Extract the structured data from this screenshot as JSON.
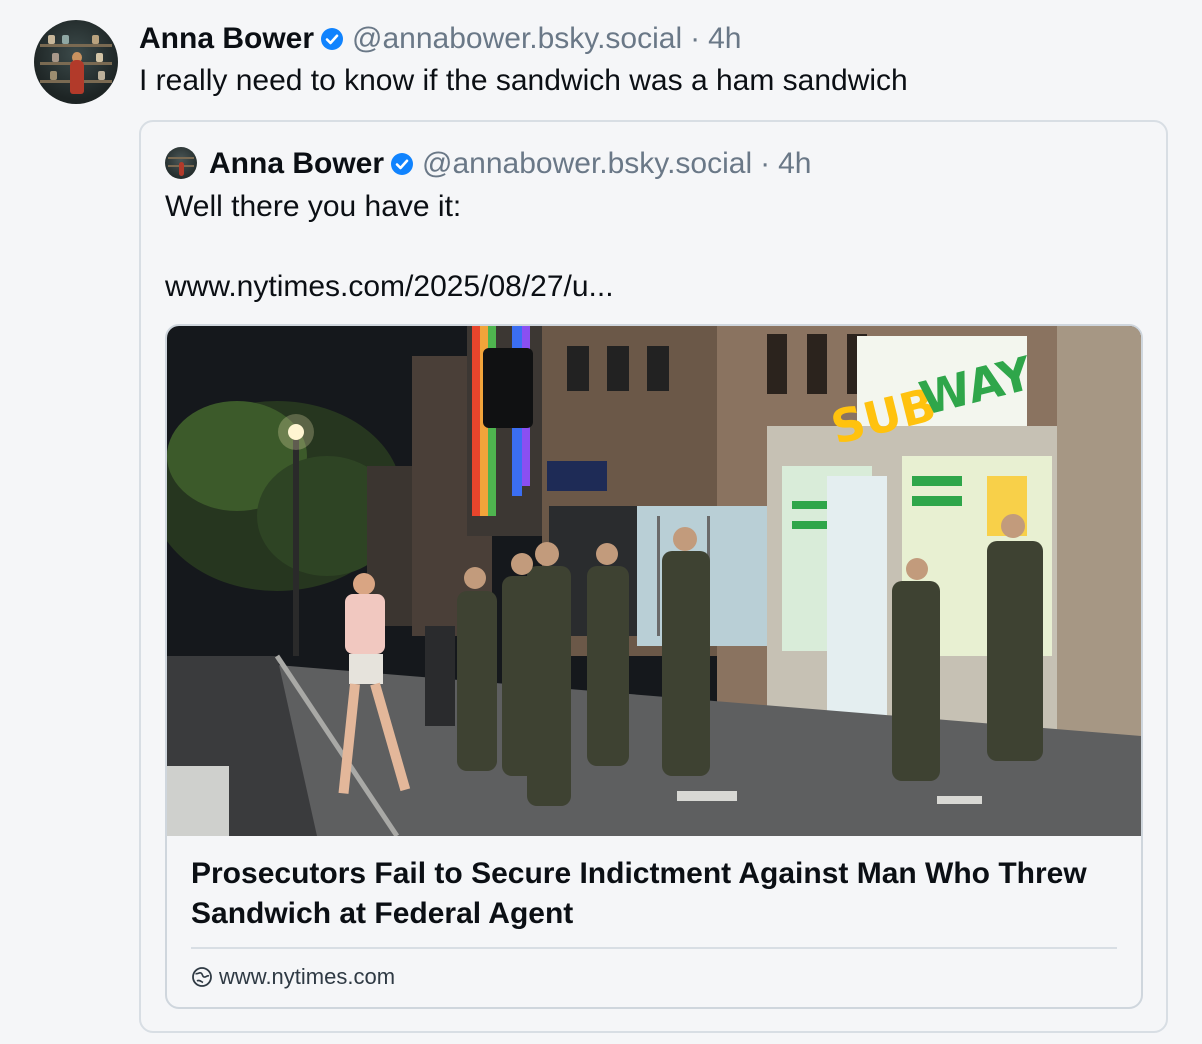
{
  "post": {
    "author": {
      "display_name": "Anna Bower",
      "handle": "@annabower.bsky.social",
      "separator": "·",
      "time": "4h"
    },
    "text": "I really need to know if the sandwich was a ham sandwich"
  },
  "quoted_post": {
    "author": {
      "display_name": "Anna Bower",
      "handle": "@annabower.bsky.social",
      "separator": "·",
      "time": "4h"
    },
    "text_line_1": "Well there you have it:",
    "text_line_2": "www.nytimes.com/2025/08/27/u..."
  },
  "link_card": {
    "title": "Prosecutors Fail to Secure Indictment Against Man Who Threw Sandwich at Federal Agent",
    "domain": "www.nytimes.com",
    "photo_sign_text": "SUBWAY",
    "icon": "globe-icon"
  },
  "colors": {
    "background": "#f5f6f8",
    "text": "#0b0f14",
    "muted": "#6a7887",
    "verified": "#1083fe",
    "border": "#d8dee4",
    "subway_yellow": "#ffc20e",
    "subway_green": "#2fa64a"
  }
}
